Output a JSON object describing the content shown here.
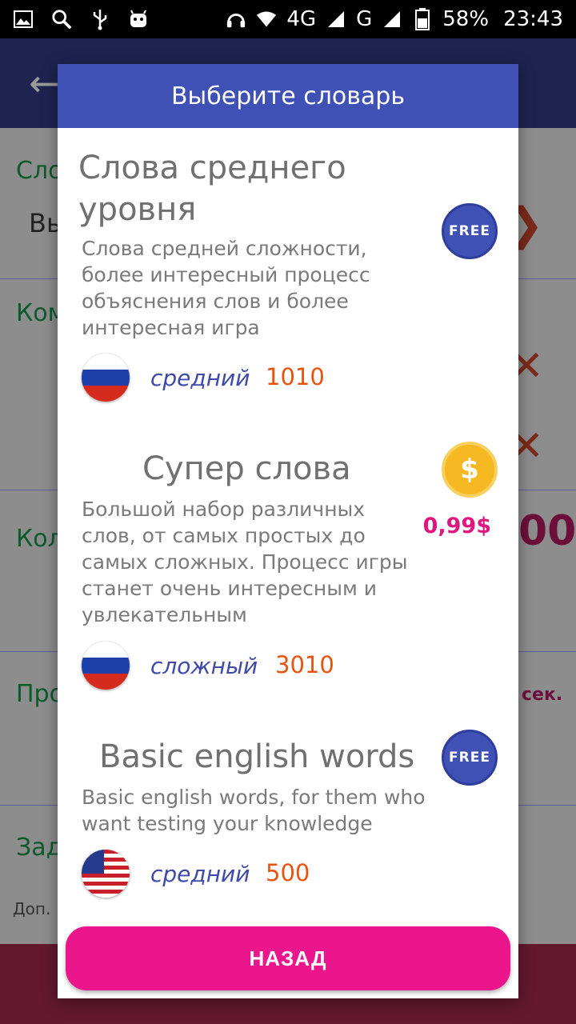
{
  "status_bar": {
    "network": "4G",
    "signal2": "G",
    "battery": "58%",
    "time": "23:43"
  },
  "background": {
    "label1": "Сло",
    "label1_value": "Вы",
    "label2": "Ком",
    "label3": "Кол",
    "label3_value": "00",
    "label4": "Про",
    "label4_value": "сек.",
    "label5": "Зад",
    "label5_sub": "Доп."
  },
  "dialog": {
    "title": "Выберите словарь",
    "dictionaries": [
      {
        "title": "Слова среднего уровня",
        "badge": "FREE",
        "description": "Слова средней сложности, более интересный процесс объяснения слов и более интересная игра",
        "flag": "russia-flag",
        "level": "средний",
        "count": "1010"
      },
      {
        "title": "Супер слова",
        "badge": "$",
        "price": "0,99$",
        "description": "Большой набор различных слов, от самых простых до самых сложных. Процесс игры станет очень интересным и увлекательным",
        "flag": "russia-flag",
        "level": "сложный",
        "count": "3010"
      },
      {
        "title": "Basic english words",
        "badge": "FREE",
        "description": "Basic english words, for them who want testing your knowledge",
        "flag": "usa-flag",
        "level": "средний",
        "count": "500"
      }
    ],
    "back_label": "НАЗАД"
  },
  "colors": {
    "header": "#3f51b5",
    "button": "#ec168c",
    "count": "#e8540f",
    "level": "#3f4aa8",
    "price": "#e0157f"
  }
}
